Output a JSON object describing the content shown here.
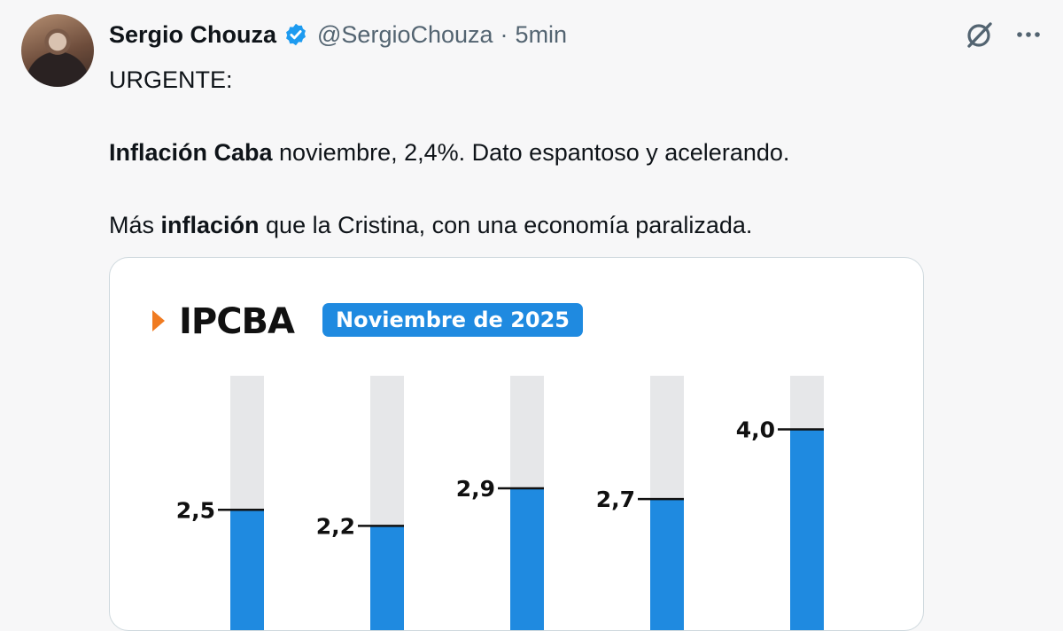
{
  "tweet": {
    "author_name": "Sergio Chouza",
    "handle": "@SergioChouza",
    "separator": "·",
    "time": "5min",
    "text": {
      "line1": "URGENTE:",
      "line2_bold": "Inflación Caba",
      "line2_rest": " noviembre, 2,4%. Dato espantoso y acelerando.",
      "line3_pre": "Más ",
      "line3_bold": "inflación",
      "line3_rest": " que la Cristina, con una economía paralizada."
    }
  },
  "icons": {
    "verified": "verified-badge-icon",
    "grok": "grok-icon",
    "more": "more-icon"
  },
  "colors": {
    "accent_blue": "#1f8ae0",
    "arrow_orange": "#f07b21",
    "bar_track": "#e6e7e9",
    "verified_blue": "#1d9bf0"
  },
  "card": {
    "title": "IPCBA",
    "badge": "Noviembre de 2025"
  },
  "chart_data": {
    "type": "bar",
    "title": "IPCBA",
    "subtitle": "Noviembre de 2025",
    "series": [
      {
        "values": [
          2.5,
          2.2,
          2.9,
          2.7,
          4.0
        ],
        "labels": [
          "2,5",
          "2,2",
          "2,9",
          "2,7",
          "4,0"
        ]
      }
    ],
    "ylim": [
      0,
      5
    ],
    "grid": false,
    "legend": "none"
  }
}
